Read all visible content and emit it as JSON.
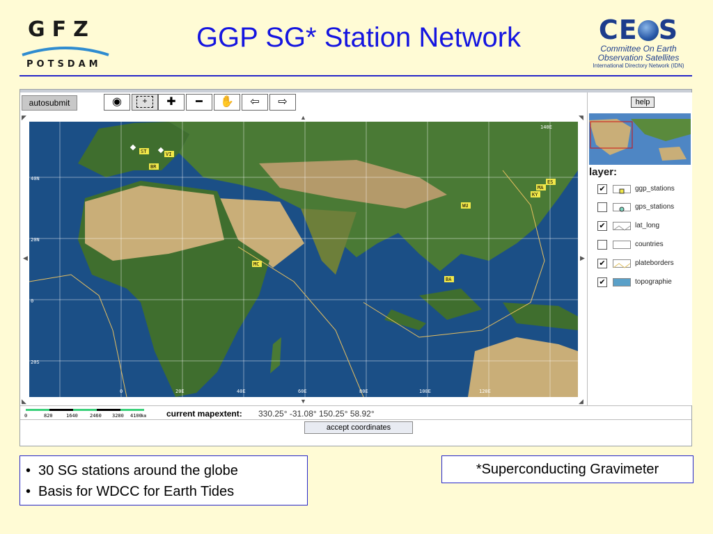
{
  "header": {
    "title": "GGP SG* Station Network",
    "gfz_logo": {
      "letters": "GFZ",
      "city": "POTSDAM"
    },
    "ceos_logo": {
      "word": "CE S",
      "line1": "Committee On Earth",
      "line2": "Observation Satellites",
      "line3": "International Directory Network (IDN)"
    }
  },
  "toolbar": {
    "autosubmit_label": "autosubmit",
    "tools": [
      {
        "name": "globe",
        "icon": "globe-icon",
        "glyph": "◉"
      },
      {
        "name": "zoom-box",
        "icon": "zoom-box-icon",
        "glyph": "+"
      },
      {
        "name": "zoom-in",
        "icon": "zoom-in-icon",
        "glyph": "✚"
      },
      {
        "name": "zoom-out",
        "icon": "zoom-out-icon",
        "glyph": "━"
      },
      {
        "name": "pan",
        "icon": "hand-icon",
        "glyph": "✋"
      },
      {
        "name": "back",
        "icon": "arrow-left-icon",
        "glyph": "⇦"
      },
      {
        "name": "forward",
        "icon": "arrow-right-icon",
        "glyph": "⇨"
      }
    ]
  },
  "map": {
    "lat_labels": [
      "40N",
      "20N",
      "0",
      "20S"
    ],
    "lon_labels": [
      "0",
      "20E",
      "40E",
      "60E",
      "80E",
      "100E",
      "120E",
      "140E"
    ],
    "stations": [
      "ST",
      "VI",
      "BR",
      "MC",
      "WU",
      "MA",
      "KY",
      "ES",
      "BA"
    ]
  },
  "scale": {
    "ticks": [
      "0",
      "820",
      "1640",
      "2460",
      "3280",
      "4100"
    ],
    "unit": "km"
  },
  "mapextent": {
    "label": "current mapextent:",
    "value": "330.25° -31.08° 150.25° 58.92°"
  },
  "accept_label": "accept coordinates",
  "side_panel": {
    "help_label": "help",
    "layer_heading": "layer:",
    "layers": [
      {
        "label": "ggp_stations",
        "checked": "✔"
      },
      {
        "label": "gps_stations",
        "checked": ""
      },
      {
        "label": "lat_long",
        "checked": "✔"
      },
      {
        "label": "countries",
        "checked": ""
      },
      {
        "label": "plateborders",
        "checked": "✔"
      },
      {
        "label": "topographie",
        "checked": "✔"
      }
    ]
  },
  "bullets": [
    "30 SG stations around the globe",
    "Basis for WDCC for Earth Tides"
  ],
  "footnote": "*Superconducting Gravimeter",
  "colors": {
    "background": "#fffbd5",
    "title": "#1515e0",
    "rule": "#2626c8",
    "ocean": "#1b4f86",
    "land_green": "#3f6e2e",
    "desert": "#c9ae78"
  }
}
